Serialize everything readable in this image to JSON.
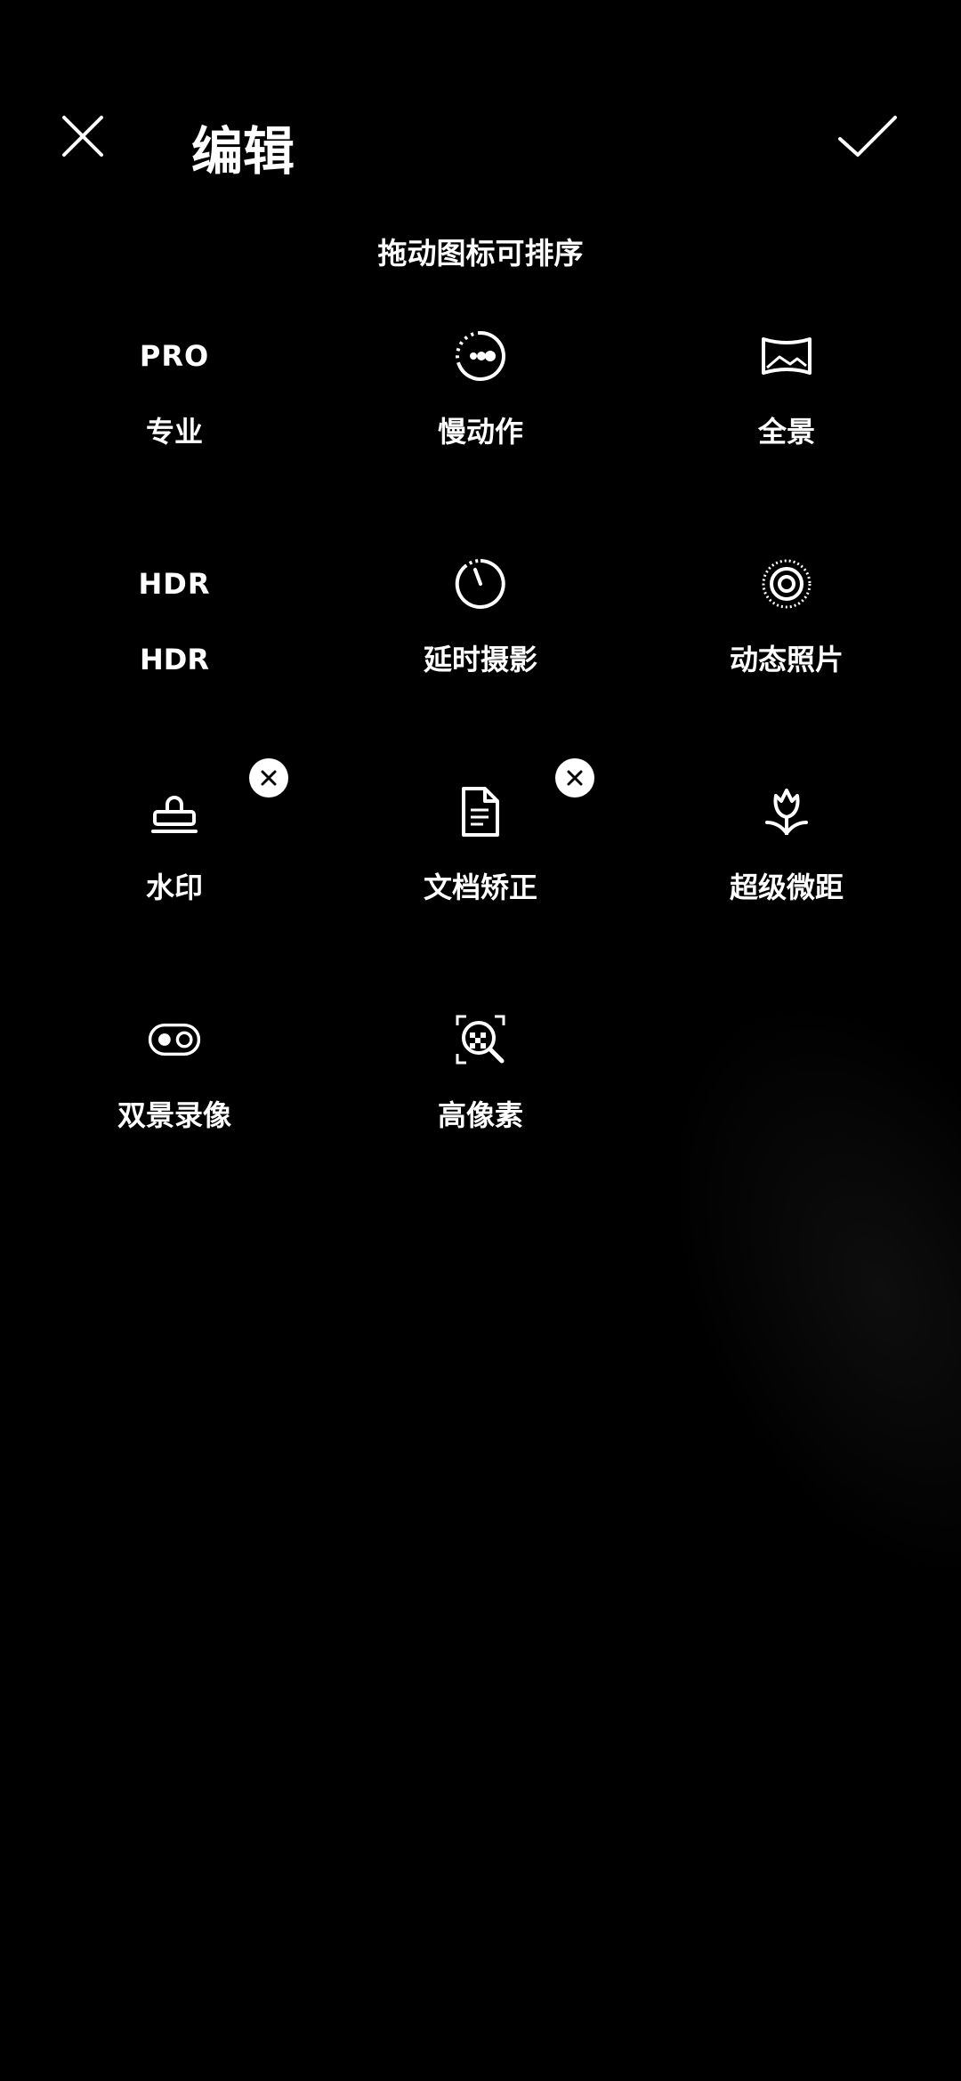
{
  "header": {
    "title": "编辑",
    "close_icon": "close-icon",
    "confirm_icon": "check-icon"
  },
  "hint": "拖动图标可排序",
  "modes": [
    {
      "label": "专业",
      "icon_text": "PRO",
      "icon": "pro-text-icon",
      "removable": false
    },
    {
      "label": "慢动作",
      "icon": "slow-motion-icon",
      "removable": false
    },
    {
      "label": "全景",
      "icon": "panorama-icon",
      "removable": false
    },
    {
      "label": "HDR",
      "icon_text": "HDR",
      "icon": "hdr-text-icon",
      "removable": false
    },
    {
      "label": "延时摄影",
      "icon": "timelapse-icon",
      "removable": false
    },
    {
      "label": "动态照片",
      "icon": "live-photo-icon",
      "removable": false
    },
    {
      "label": "水印",
      "icon": "stamp-icon",
      "removable": true
    },
    {
      "label": "文档矫正",
      "icon": "document-icon",
      "removable": true
    },
    {
      "label": "超级微距",
      "icon": "macro-flower-icon",
      "removable": false
    },
    {
      "label": "双景录像",
      "icon": "dual-view-icon",
      "removable": false
    },
    {
      "label": "高像素",
      "icon": "high-pixel-icon",
      "removable": false
    }
  ],
  "colors": {
    "background": "#000000",
    "foreground": "#ffffff"
  }
}
